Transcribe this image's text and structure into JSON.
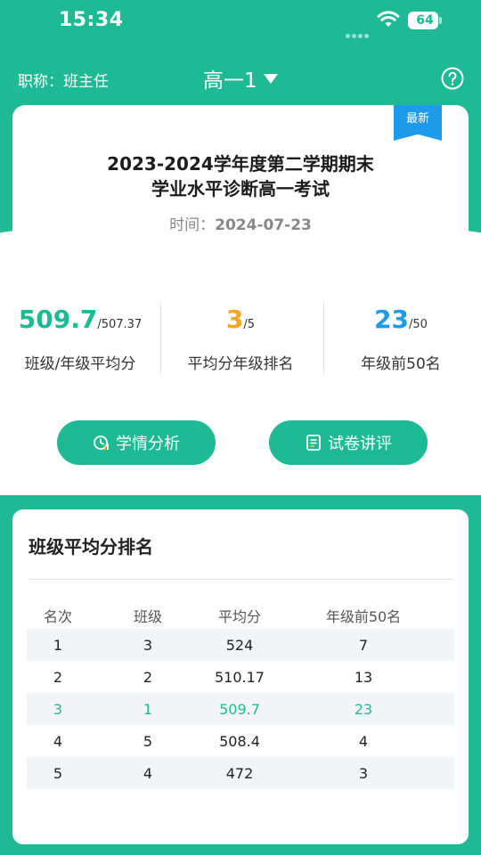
{
  "status_bar": {
    "time": "15:34",
    "battery": "64"
  },
  "nav": {
    "role_label": "职称：班主任",
    "class_selector": "高一1"
  },
  "exam": {
    "badge": "最新",
    "title_line1": "2023-2024学年度第二学期期末",
    "title_line2": "学业水平诊断高一考试",
    "time_label": "时间：",
    "time_value": "2024-07-23"
  },
  "stats": [
    {
      "value": "509.7",
      "suffix": "/507.37",
      "caption": "班级/年级平均分",
      "color": "#1dba95"
    },
    {
      "value": "3",
      "suffix": "/5",
      "caption": "平均分年级排名",
      "color": "#f5a623"
    },
    {
      "value": "23",
      "suffix": "/50",
      "caption": "年级前50名",
      "color": "#1e9be8"
    }
  ],
  "actions": {
    "analysis_label": "学情分析",
    "review_label": "试卷讲评"
  },
  "ranking": {
    "title": "班级平均分排名",
    "columns": [
      "名次",
      "班级",
      "平均分",
      "年级前50名"
    ],
    "rows": [
      [
        "1",
        "3",
        "524",
        "7"
      ],
      [
        "2",
        "2",
        "510.17",
        "13"
      ],
      [
        "3",
        "1",
        "509.7",
        "23"
      ],
      [
        "4",
        "5",
        "508.4",
        "4"
      ],
      [
        "5",
        "4",
        "472",
        "3"
      ]
    ],
    "highlight_color": "#1dba95"
  },
  "colors": {
    "primary": "#1dba95",
    "badge": "#1e9be8",
    "rank_accent": "#f5a623"
  }
}
